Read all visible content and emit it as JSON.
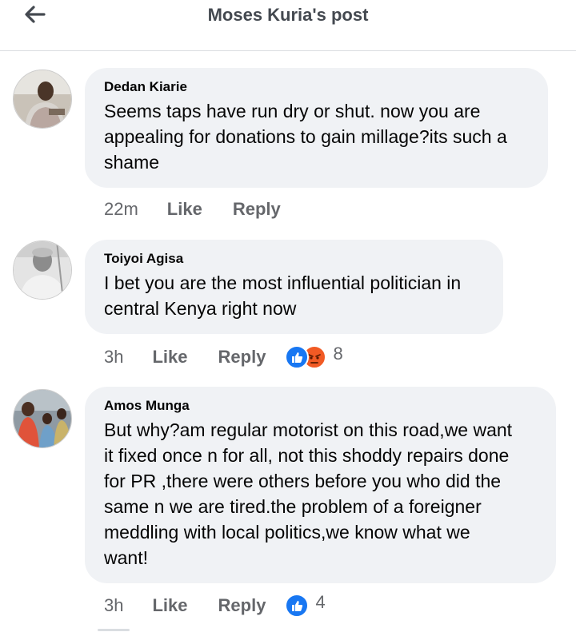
{
  "header": {
    "title": "Moses Kuria's post",
    "back_icon": "back-arrow-icon"
  },
  "comments": [
    {
      "author": "Dedan Kiarie",
      "lines": [
        "Seems taps have run dry or shut. now you are",
        "appealing for donations to gain millage?its such a",
        "shame"
      ],
      "time": "22m",
      "like_label": "Like",
      "reply_label": "Reply",
      "reaction_count": null
    },
    {
      "author": "Toiyoi Agisa",
      "lines": [
        "I bet you are the most influential politician in",
        "central Kenya right now"
      ],
      "time": "3h",
      "like_label": "Like",
      "reply_label": "Reply",
      "reactions": [
        "like",
        "angry"
      ],
      "reaction_count": "8"
    },
    {
      "author": "Amos Munga",
      "lines": [
        "But why?am regular motorist on this road,we want",
        "it fixed  once n for all, not this shoddy repairs done",
        "for PR ,there were others before you who did the",
        "same n we are tired.the problem of a foreigner",
        "meddling with local politics,we know what we",
        "want!"
      ],
      "time": "3h",
      "like_label": "Like",
      "reply_label": "Reply",
      "reactions": [
        "like"
      ],
      "reaction_count": "4"
    }
  ],
  "colors": {
    "like_blue": "#1877f2",
    "angry_orange": "#f15a24",
    "bubble_gray": "#f0f2f5",
    "meta_gray": "#65676b"
  }
}
